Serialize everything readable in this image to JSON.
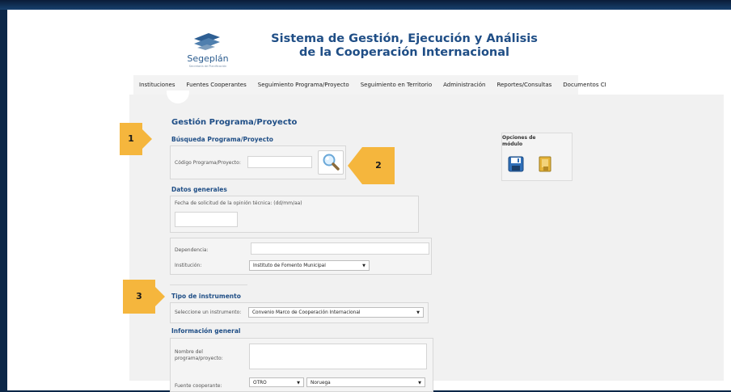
{
  "header": {
    "logo_text": "Segeplán",
    "logo_sub": "Secretaría de Planificación",
    "title_line1": "Sistema de Gestión, Ejecución y Análisis",
    "title_line2": "de la Cooperación Internacional"
  },
  "nav": {
    "items": [
      "Instituciones",
      "Fuentes Cooperantes",
      "Seguimiento Programa/Proyecto",
      "Seguimiento en Territorio",
      "Administración",
      "Reportes/Consultas",
      "Documentos CI"
    ]
  },
  "page": {
    "title": "Gestión Programa/Proyecto"
  },
  "busqueda": {
    "title": "Búsqueda Programa/Proyecto",
    "codigo_label": "Código Programa/Proyecto:",
    "codigo_value": ""
  },
  "datos": {
    "title": "Datos generales",
    "fecha_label": "Fecha de solicitud de la opinión técnica: (dd/mm/aa)",
    "fecha_value": "",
    "dependencia_label": "Dependencia:",
    "dependencia_value": "",
    "institucion_label": "Institución:",
    "institucion_value": "Instituto de Fomento Municipal"
  },
  "instrumento": {
    "title": "Tipo de instrumento",
    "select_label": "Seleccione un instrumento:",
    "select_value": "Convenio Marco de Cooperación Internacional"
  },
  "info": {
    "title": "Información general",
    "nombre_label": "Nombre del programa/proyecto:",
    "fuente_label": "Fuente cooperante:",
    "fuente_tipo": "OTRO",
    "fuente_pais": "Noruega"
  },
  "opciones": {
    "title": "Opciones de módulo"
  },
  "callouts": [
    "1",
    "2",
    "3"
  ],
  "colors": {
    "accent": "#1f4e86",
    "callout": "#f5b63d",
    "frame": "#0c2748"
  }
}
